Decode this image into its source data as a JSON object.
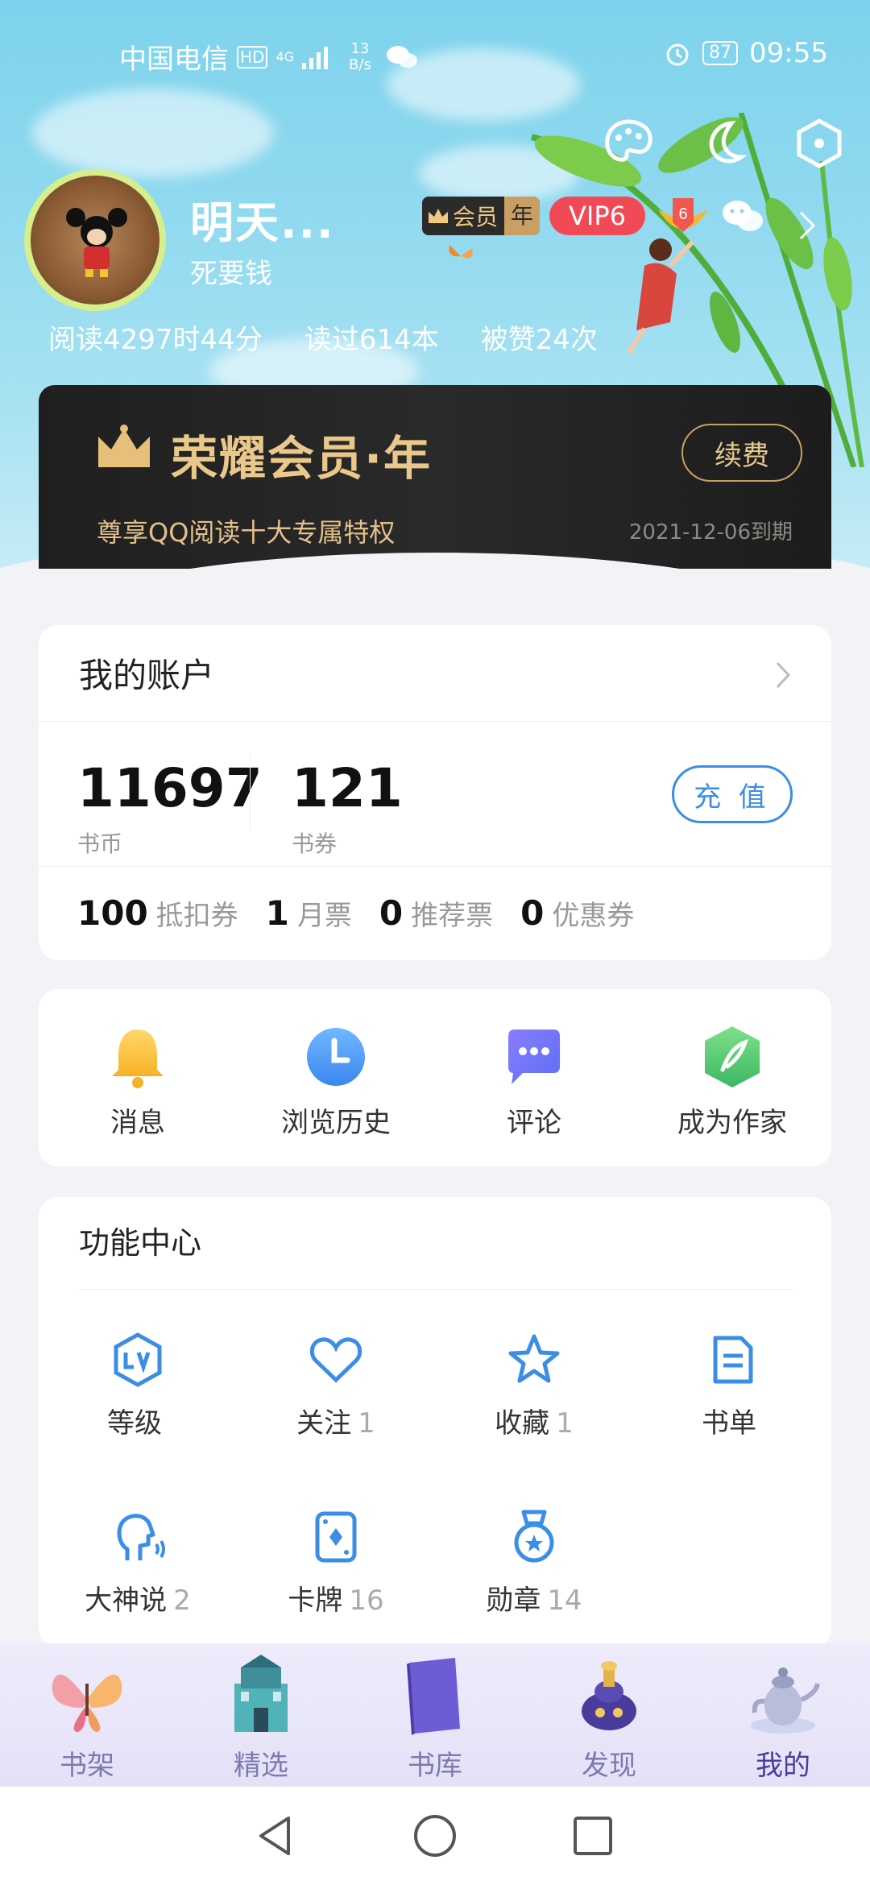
{
  "status_bar": {
    "carrier": "中国电信",
    "hd": "HD",
    "network": "4G",
    "speed_value": "13",
    "speed_unit": "B/s",
    "battery": "87",
    "time": "09:55"
  },
  "profile": {
    "name": "明天...",
    "signature": "死要钱",
    "member_badge": "会员",
    "member_badge_period": "年",
    "vip_badge": "VIP6",
    "level_badge": "6",
    "stats": [
      "阅读4297时44分",
      "读过614本",
      "被赞24次"
    ]
  },
  "member_card": {
    "title": "荣耀会员·年",
    "subtitle": "尊享QQ阅读十大专属特权",
    "expire": "2021-12-06到期",
    "renew_label": "续费"
  },
  "account": {
    "title": "我的账户",
    "coins": {
      "value": "11697",
      "label": "书币"
    },
    "coupons": {
      "value": "121",
      "label": "书券"
    },
    "recharge_label": "充 值",
    "tickets": [
      {
        "value": "100",
        "label": "抵扣券"
      },
      {
        "value": "1",
        "label": "月票"
      },
      {
        "value": "0",
        "label": "推荐票"
      },
      {
        "value": "0",
        "label": "优惠券"
      }
    ]
  },
  "quick_actions": [
    {
      "label": "消息",
      "icon": "bell-icon"
    },
    {
      "label": "浏览历史",
      "icon": "clock-icon"
    },
    {
      "label": "评论",
      "icon": "comment-icon"
    },
    {
      "label": "成为作家",
      "icon": "quill-icon"
    }
  ],
  "function_center": {
    "title": "功能中心",
    "items": [
      {
        "label": "等级",
        "count": "",
        "icon": "level-icon"
      },
      {
        "label": "关注",
        "count": "1",
        "icon": "heart-icon"
      },
      {
        "label": "收藏",
        "count": "1",
        "icon": "star-icon"
      },
      {
        "label": "书单",
        "count": "",
        "icon": "booklist-icon"
      },
      {
        "label": "大神说",
        "count": "2",
        "icon": "speaker-icon"
      },
      {
        "label": "卡牌",
        "count": "16",
        "icon": "card-icon"
      },
      {
        "label": "勋章",
        "count": "14",
        "icon": "medal-icon"
      }
    ]
  },
  "bottom_nav": [
    {
      "label": "书架",
      "icon": "butterfly-icon"
    },
    {
      "label": "精选",
      "icon": "castle-icon"
    },
    {
      "label": "书库",
      "icon": "book-icon"
    },
    {
      "label": "发现",
      "icon": "lamp-icon"
    },
    {
      "label": "我的",
      "icon": "teapot-icon",
      "active": true
    }
  ],
  "colors": {
    "accent": "#3a8ee6",
    "gold": "#e9c88a",
    "vip_red": "#f24957",
    "nav_active": "#4a3d9c"
  }
}
